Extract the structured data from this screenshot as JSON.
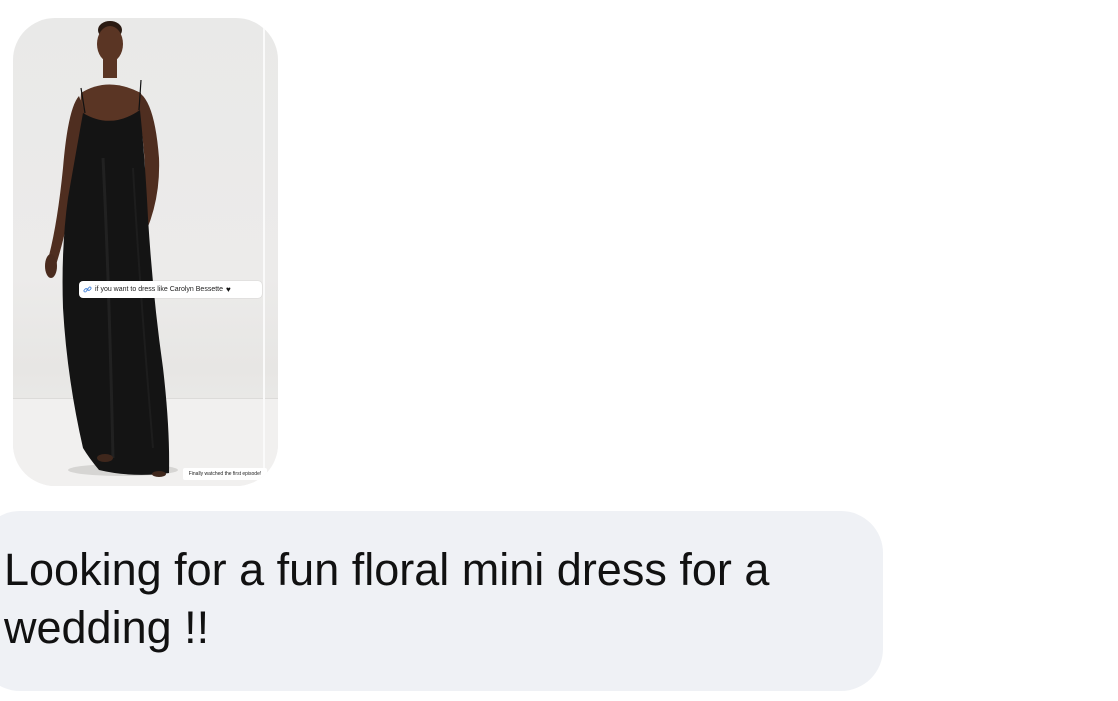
{
  "shared_media": {
    "sticker_text": "if you want to dress like Carolyn Bessette",
    "sticker_link_icon": "link-icon",
    "sticker_emoji_icon": "black-heart-icon",
    "caption_text": "Finally watched the first episode!"
  },
  "message": {
    "text": "Looking for a fun floral mini dress for a wedding !!"
  },
  "colors": {
    "bubble_background": "#eff1f5",
    "text": "#111111",
    "page_background": "#ffffff"
  }
}
